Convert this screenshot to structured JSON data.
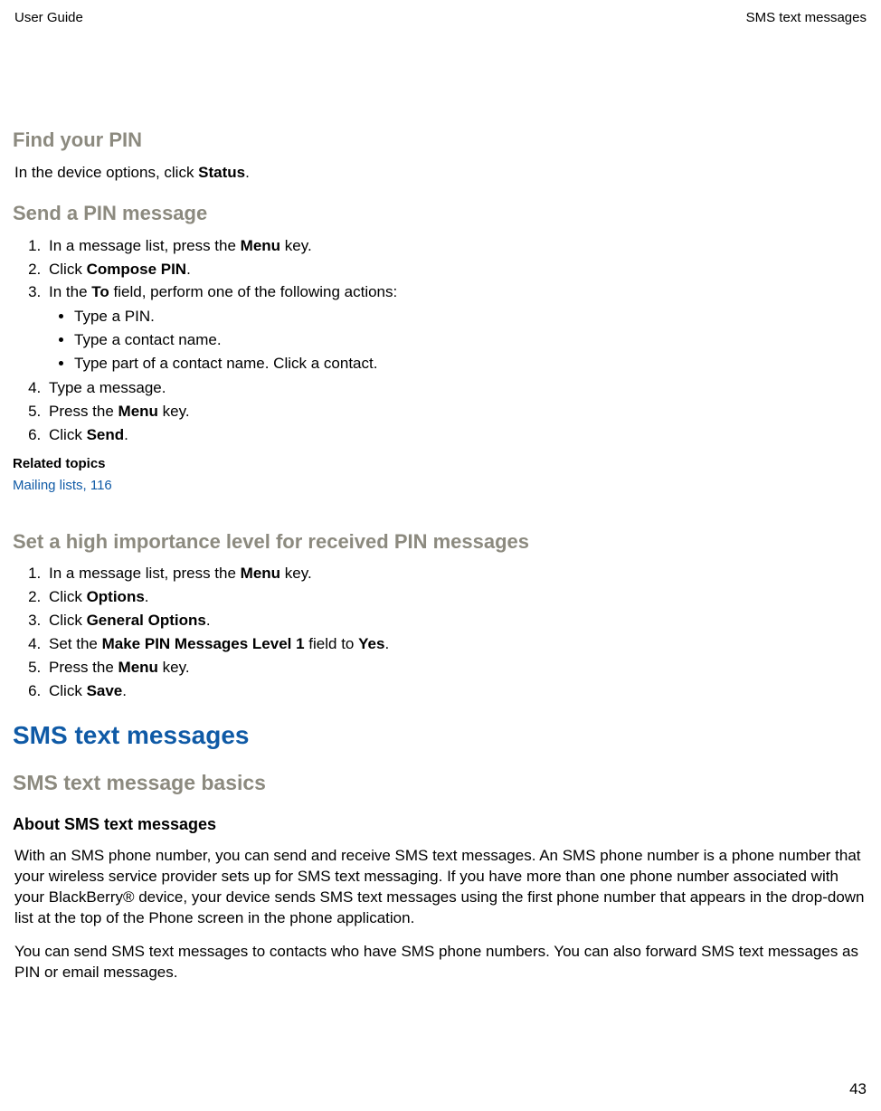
{
  "header": {
    "left": "User Guide",
    "right": "SMS text messages"
  },
  "sections": {
    "find_pin": {
      "title": "Find your PIN",
      "body_before": "In the device options, click ",
      "body_bold": "Status",
      "body_after": "."
    },
    "send_pin": {
      "title": "Send a PIN message",
      "step1_before": "In a message list, press the ",
      "step1_bold": "Menu",
      "step1_after": " key.",
      "step2_before": "Click ",
      "step2_bold": "Compose PIN",
      "step2_after": ".",
      "step3_before": "In the ",
      "step3_bold": "To",
      "step3_after": " field, perform one of the following actions:",
      "bullet1": "Type a PIN.",
      "bullet2": "Type a contact name.",
      "bullet3": "Type part of a contact name. Click a contact.",
      "step4": "Type a message.",
      "step5_before": "Press the ",
      "step5_bold": "Menu",
      "step5_after": " key.",
      "step6_before": "Click ",
      "step6_bold": "Send",
      "step6_after": "."
    },
    "related": {
      "heading": "Related topics",
      "link": "Mailing lists, 116"
    },
    "high_importance": {
      "title": "Set a high importance level for received PIN messages",
      "step1_before": "In a message list, press the ",
      "step1_bold": "Menu",
      "step1_after": " key.",
      "step2_before": "Click ",
      "step2_bold": "Options",
      "step2_after": ".",
      "step3_before": "Click ",
      "step3_bold": "General Options",
      "step3_after": ".",
      "step4_before": "Set the ",
      "step4_bold1": "Make PIN Messages Level 1",
      "step4_mid": " field to ",
      "step4_bold2": "Yes",
      "step4_after": ".",
      "step5_before": "Press the ",
      "step5_bold": "Menu",
      "step5_after": " key.",
      "step6_before": "Click ",
      "step6_bold": "Save",
      "step6_after": "."
    },
    "sms": {
      "main_title": "SMS text messages",
      "sub_title": "SMS text message basics",
      "topic_title": "About SMS text messages",
      "para1": "With an SMS phone number, you can send and receive SMS text messages. An SMS phone number is a phone number that your wireless service provider sets up for SMS text messaging. If you have more than one phone number associated with your BlackBerry® device, your device sends SMS text messages using the first phone number that appears in the drop-down list at the top of the Phone screen in the phone application.",
      "para2": "You can send SMS text messages to contacts who have SMS phone numbers. You can also forward SMS text messages as PIN or email messages."
    }
  },
  "page_number": "43"
}
